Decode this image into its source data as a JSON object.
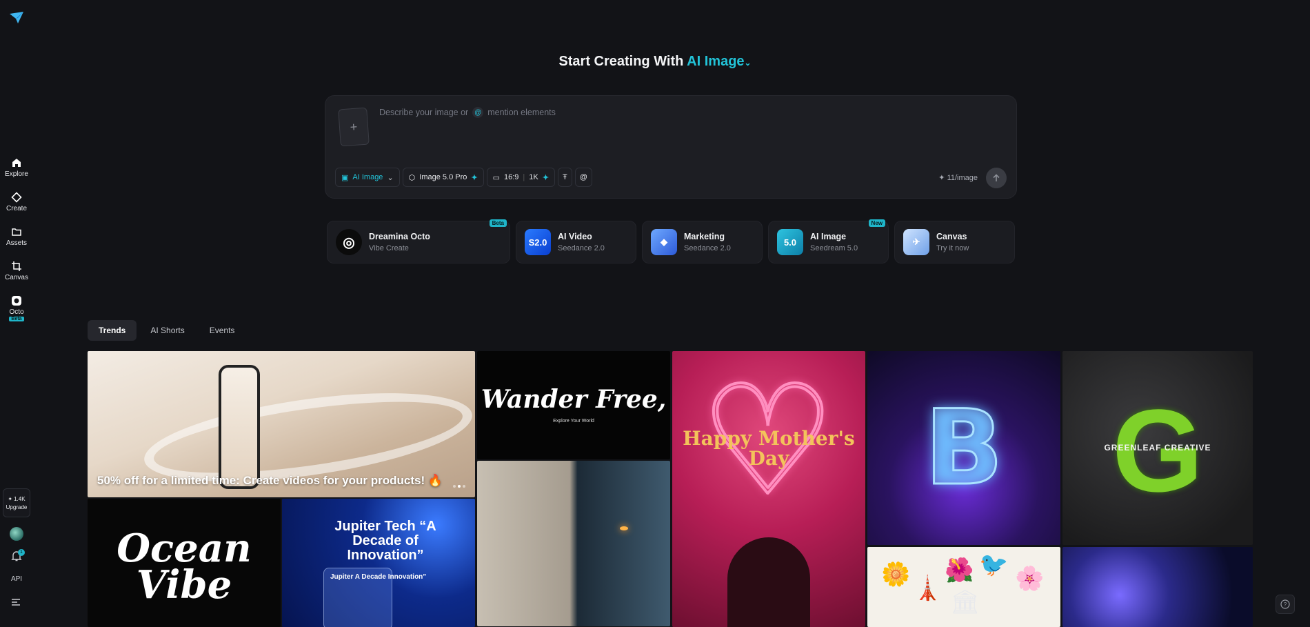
{
  "sidebar": {
    "items": [
      {
        "label": "Explore",
        "icon": "home-icon"
      },
      {
        "label": "Create",
        "icon": "diamond-icon"
      },
      {
        "label": "Assets",
        "icon": "folder-icon"
      },
      {
        "label": "Canvas",
        "icon": "canvas-icon"
      },
      {
        "label": "Octo",
        "icon": "octo-icon",
        "badge": "Beta"
      }
    ],
    "credits": "1.4K",
    "upgrade_label": "Upgrade",
    "notification_count": "1",
    "api_label": "API"
  },
  "headline": {
    "prefix": "Start Creating With",
    "mode": "AI Image"
  },
  "composer": {
    "placeholder_prefix": "Describe your image or",
    "placeholder_suffix": "mention elements",
    "toolbar": {
      "mode": "AI Image",
      "model": "Image 5.0 Pro",
      "ratio": "16:9",
      "resolution": "1K"
    },
    "cost": "11/image"
  },
  "tools": [
    {
      "name": "Dreamina Octo",
      "sub": "Vibe Create",
      "badge": "Beta"
    },
    {
      "name": "AI Video",
      "sub": "Seedance 2.0",
      "icon_text": "S2.0"
    },
    {
      "name": "Marketing",
      "sub": "Seedance 2.0"
    },
    {
      "name": "AI Image",
      "sub": "Seedream 5.0",
      "badge": "New",
      "icon_text": "5.0"
    },
    {
      "name": "Canvas",
      "sub": "Try it now"
    }
  ],
  "tabs": [
    "Trends",
    "AI Shorts",
    "Events"
  ],
  "gallery": {
    "banner_text": "50% off for a limited time: Create videos for your products! 🔥",
    "wander_title": "Wander Free,",
    "wander_sub": "Explore Your World",
    "mother_text": "Happy Mother's Day",
    "btc_symbol": "B",
    "greenleaf_text": "GREENLEAF CREATIVE",
    "ocean_text": "Ocean Vibe",
    "jupiter_title": "Jupiter Tech “A Decade of Innovation”",
    "jupiter_small": "Jupiter A Decade Innovation”"
  },
  "colors": {
    "accent": "#22c3d8",
    "background": "#121317",
    "panel": "#1d1e23"
  }
}
